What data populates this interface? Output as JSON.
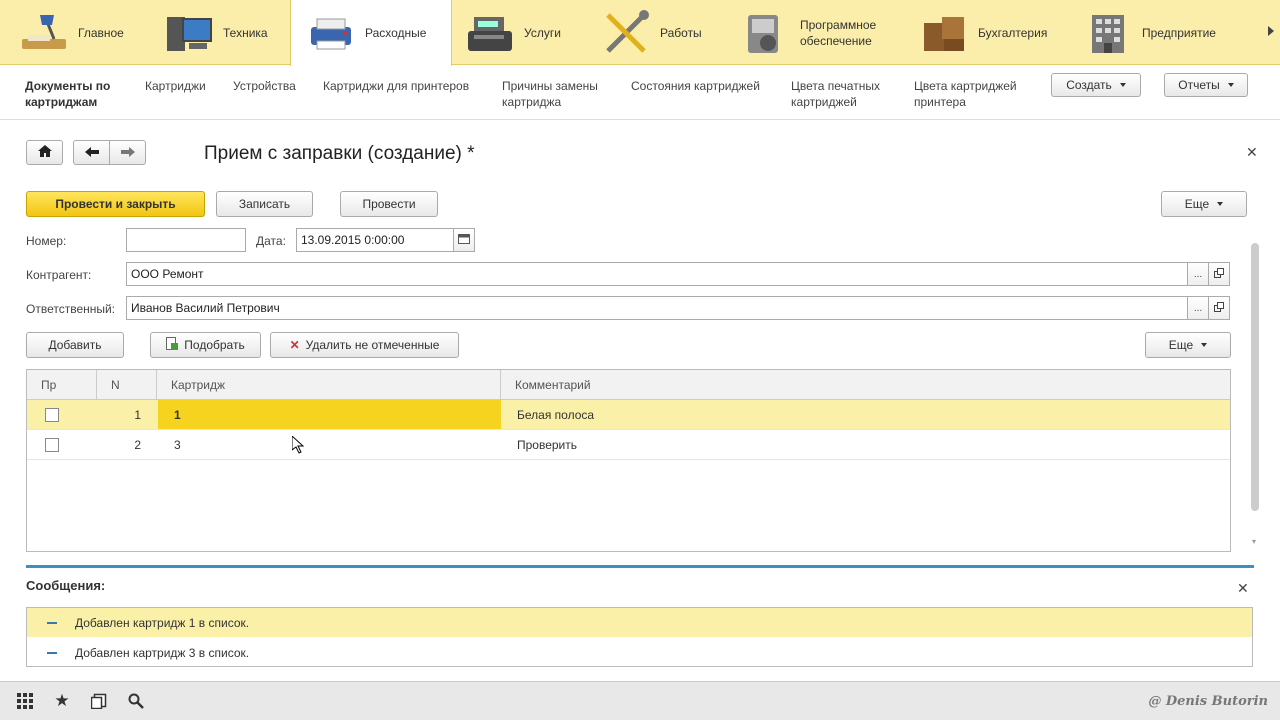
{
  "sections": [
    {
      "label": "Главное",
      "icon": "desk-lamp-icon"
    },
    {
      "label": "Техника",
      "icon": "computer-icon"
    },
    {
      "label": "Расходные",
      "icon": "printer-icon",
      "active": true
    },
    {
      "label": "Услуги",
      "icon": "cash-register-icon"
    },
    {
      "label": "Работы",
      "icon": "tools-icon"
    },
    {
      "label": "Программное обеспечение",
      "icon": "software-icon"
    },
    {
      "label": "Бухгалтерия",
      "icon": "boxes-icon"
    },
    {
      "label": "Предприятие",
      "icon": "building-icon"
    }
  ],
  "nav": {
    "items": [
      "Документы по картриджам",
      "Картриджи",
      "Устройства",
      "Картриджи для принтеров",
      "Причины замены картриджа",
      "Состояния картриджей",
      "Цвета печатных картриджей",
      "Цвета картриджей принтера"
    ],
    "create_label": "Создать",
    "reports_label": "Отчеты"
  },
  "form": {
    "title": "Прием с заправки (создание) *",
    "post_close_label": "Провести и закрыть",
    "save_label": "Записать",
    "post_label": "Провести",
    "more_label": "Еще",
    "number_label": "Номер:",
    "number_value": "",
    "date_label": "Дата:",
    "date_value": "13.09.2015  0:00:00",
    "counterparty_label": "Контрагент:",
    "counterparty_value": "ООО Ремонт",
    "responsible_label": "Ответственный:",
    "responsible_value": "Иванов Василий Петрович",
    "select_button_label": "...",
    "add_label": "Добавить",
    "pick_label": "Подобрать",
    "delete_unchecked_label": "Удалить не отмеченные",
    "table_more_label": "Еще"
  },
  "table": {
    "columns": [
      "Пр",
      "N",
      "Картридж",
      "Комментарий"
    ],
    "rows": [
      {
        "checked": false,
        "n": "1",
        "cartridge": "1",
        "comment": "Белая полоса"
      },
      {
        "checked": false,
        "n": "2",
        "cartridge": "3",
        "comment": "Проверить"
      }
    ]
  },
  "messages": {
    "title": "Сообщения:",
    "items": [
      "Добавлен картридж 1 в список.",
      "Добавлен картридж 3 в список."
    ]
  },
  "watermark": "@ Denis Butorin",
  "colors": {
    "sections_bg": "#fbeeaa",
    "primary_button": "#f6d31e",
    "selected_row": "#fbf0a8",
    "accent_line": "#3a8fc5"
  }
}
